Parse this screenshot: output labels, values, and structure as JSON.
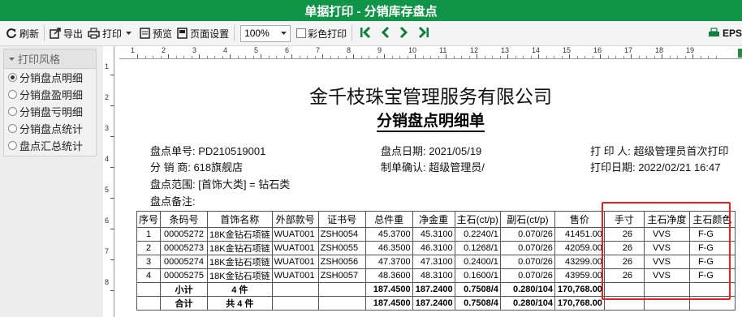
{
  "window": {
    "title": "单据打印 - 分销库存盘点"
  },
  "toolbar": {
    "refresh": "刷新",
    "export": "导出",
    "print": "打印",
    "preview": "预览",
    "page_setup": "页面设置",
    "zoom": "100%",
    "color_print": "彩色打印",
    "eps": "EPS"
  },
  "style_panel": {
    "title": "打印风格",
    "options": [
      "分销盘点明细",
      "分销盘盈明细",
      "分销盘亏明细",
      "分销盘点统计",
      "盘点汇总统计"
    ],
    "selected": "分销盘点明细"
  },
  "rulers": {
    "h_ticks": [
      "1",
      "2",
      "3",
      "4",
      "5",
      "6",
      "7",
      "8",
      "9",
      "10",
      "11",
      "12",
      "13",
      "14",
      "15",
      "16",
      "17",
      "18",
      "19"
    ],
    "v_ticks": [
      "1",
      "2",
      "3",
      "4",
      "5",
      "6",
      "7",
      "8"
    ]
  },
  "doc": {
    "company": "金千枝珠宝管理服务有限公司",
    "title": "分销盘点明细单",
    "fields": {
      "stock_no": "盘点单号: PD210519001",
      "stock_date": "盘点日期: 2021/05/19",
      "printer": "打 印 人: 超级管理员首次打印",
      "dealer": "分 销 商: 618旗舰店",
      "confirm": "制单确认: 超级管理员/",
      "print_date": "打印日期: 2022/02/21 16:47",
      "scope": "盘点范围: [首饰大类] = 钻石类",
      "remark": "盘点备注:"
    }
  },
  "table": {
    "headers": [
      "序号",
      "条码号",
      "首饰名称",
      "外部款号",
      "证书号",
      "总件重",
      "净金重",
      "主石(ct/p)",
      "副石(ct/p)",
      "售价",
      "手寸",
      "主石净度",
      "主石颜色"
    ],
    "rows": [
      [
        "1",
        "00005272",
        "18K金钻石项链",
        "WUAT001",
        "ZSH0054",
        "45.3700",
        "45.3100",
        "0.2240/1",
        "0.070/26",
        "41451.00",
        "26",
        "VVS",
        "F-G"
      ],
      [
        "2",
        "00005273",
        "18K金钻石项链",
        "WUAT001",
        "ZSH0055",
        "46.3500",
        "46.3100",
        "0.1268/1",
        "0.070/26",
        "42059.00",
        "26",
        "VVS",
        "F-G"
      ],
      [
        "3",
        "00005274",
        "18K金钻石项链",
        "WUAT001",
        "ZSH0056",
        "47.3700",
        "47.3100",
        "0.2400/1",
        "0.070/26",
        "43299.00",
        "26",
        "VVS",
        "F-G"
      ],
      [
        "4",
        "00005275",
        "18K金钻石项链",
        "WUAT001",
        "ZSH0057",
        "48.3600",
        "48.3100",
        "0.1600/1",
        "0.070/26",
        "43959.00",
        "26",
        "VVS",
        "F-G"
      ]
    ],
    "subtotal": {
      "label": "小计",
      "count": "4 件",
      "total_weight": "187.4500",
      "net_gold": "187.2400",
      "main_stone": "0.7508/4",
      "side_stone": "0.280/104",
      "price": "170,768.00"
    },
    "total": {
      "label": "合计",
      "count": "共 4 件",
      "total_weight": "187.4500",
      "net_gold": "187.2400",
      "main_stone": "0.7508/4",
      "side_stone": "0.280/104",
      "price": "170,768.00"
    }
  },
  "colors": {
    "titlebar": "#109447",
    "nav_arrows": "#0d7f3f",
    "highlight": "#e52020"
  }
}
